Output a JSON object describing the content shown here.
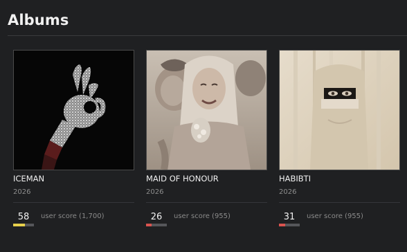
{
  "section": {
    "title": "Albums"
  },
  "albums": [
    {
      "title": "ICEMAN",
      "year": "2026",
      "score": "58",
      "score_fraction": 0.58,
      "score_color": "#e6cf4c",
      "score_label": "user score (1,700)",
      "cover_icon": "ok-hand-glove-art"
    },
    {
      "title": "MAID OF HONOUR",
      "year": "2026",
      "score": "26",
      "score_fraction": 0.26,
      "score_color": "#d9534f",
      "score_label": "user score (955)",
      "cover_icon": "couple-portrait-art"
    },
    {
      "title": "HABIBTI",
      "year": "2026",
      "score": "31",
      "score_fraction": 0.31,
      "score_color": "#d9534f",
      "score_label": "user score (955)",
      "cover_icon": "veiled-face-art"
    }
  ]
}
